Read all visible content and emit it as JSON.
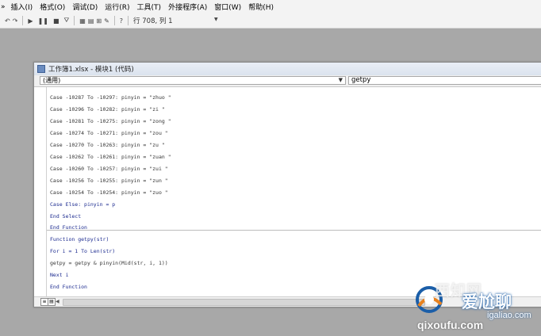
{
  "menubar": {
    "items": [
      "»",
      "插入(I)",
      "格式(O)",
      "调试(D)",
      "运行(R)",
      "工具(T)",
      "外接程序(A)",
      "窗口(W)",
      "帮助(H)"
    ]
  },
  "toolbar": {
    "icons": [
      "undo-icon",
      "redo-icon",
      "run-icon",
      "break-icon",
      "reset-icon",
      "design-mode-icon",
      "project-explorer-icon",
      "properties-icon",
      "object-browser-icon",
      "toolbox-icon",
      "help-icon"
    ],
    "status": "行 708, 列 1"
  },
  "code_window": {
    "title": "工作簿1.xlsx - 模块1 (代码)",
    "object_combo": "(通用)",
    "procedure_combo": "getpy",
    "lines": [
      {
        "pre": "Case ",
        "text": "Case -10287 To -10297: pinyin = \"zhuo \""
      },
      {
        "text": "Case -10296 To -10282: pinyin = \"zi \""
      },
      {
        "text": "Case -10281 To -10275: pinyin = \"zong \""
      },
      {
        "text": "Case -10274 To -10271: pinyin = \"zou \""
      },
      {
        "text": "Case -10270 To -10263: pinyin = \"zu \""
      },
      {
        "text": "Case -10262 To -10261: pinyin = \"zuan \""
      },
      {
        "text": "Case -10260 To -10257: pinyin = \"zui \""
      },
      {
        "text": "Case -10256 To -10255: pinyin = \"zun \""
      },
      {
        "text": "Case -10254 To -10254: pinyin = \"zuo \""
      },
      {
        "text": "Case Else: pinyin = p"
      },
      {
        "text": "End Select"
      },
      {
        "text": "End Function"
      },
      {
        "text": "Function getpy(str)"
      },
      {
        "text": "For i = 1 To Len(str)"
      },
      {
        "text": "getpy = getpy & pinyin(Mid(str, i, 1))"
      },
      {
        "text": "Next i"
      },
      {
        "text": "End Function"
      }
    ]
  },
  "watermark": {
    "chinese": "西知网",
    "app_name": "爱尬聊",
    "domain": "igaliao.com",
    "domain2": "qixoufu.com"
  },
  "colors": {
    "background": "#a8a8a8",
    "keyword": "#1b2a8f",
    "title_gradient": "#dbe3ee",
    "watermark_blue": "#1b5ea8",
    "watermark_orange": "#e8821e"
  }
}
